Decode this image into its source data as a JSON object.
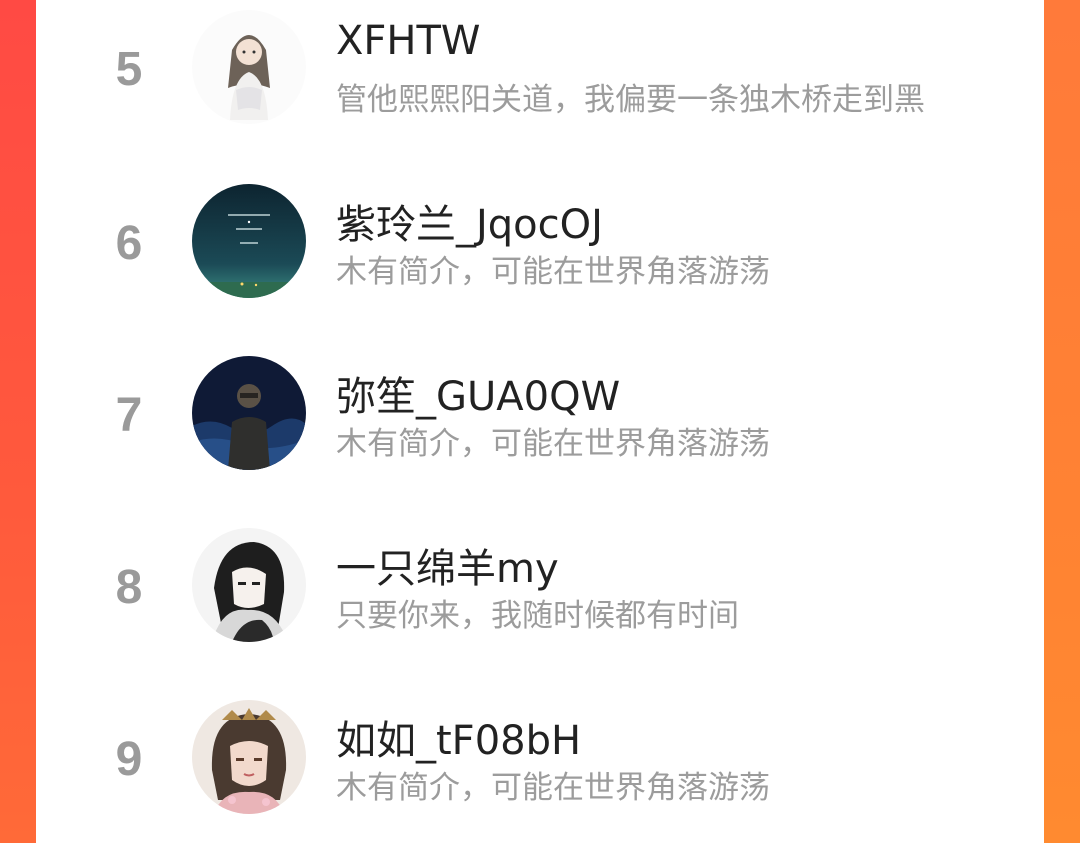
{
  "colors": {
    "accent_left": "#ff4a44",
    "accent_right": "#ff8a30",
    "rank_number": "#9a9a9a",
    "nickname": "#222222",
    "bio": "#9c9c9c"
  },
  "ranking": {
    "items": [
      {
        "rank": "5",
        "nickname": "XFHTW",
        "bio": "管他熙熙阳关道，我偏要一条独木桥走到黑",
        "avatar": "anime-girl-white-dress-avatar"
      },
      {
        "rank": "6",
        "nickname": "紫玲兰_JqocOJ",
        "bio": "木有简介，可能在世界角落游荡",
        "avatar": "night-sky-text-avatar"
      },
      {
        "rank": "7",
        "nickname": "弥笙_GUA0QW",
        "bio": "木有简介，可能在世界角落游荡",
        "avatar": "dark-figure-ocean-avatar"
      },
      {
        "rank": "8",
        "nickname": "一只绵羊my",
        "bio": "只要你来，我随时候都有时间",
        "avatar": "manga-girl-black-hair-avatar"
      },
      {
        "rank": "9",
        "nickname": "如如_tF08bH",
        "bio": "木有简介，可能在世界角落游荡",
        "avatar": "traditional-girl-hairpiece-avatar"
      }
    ]
  }
}
